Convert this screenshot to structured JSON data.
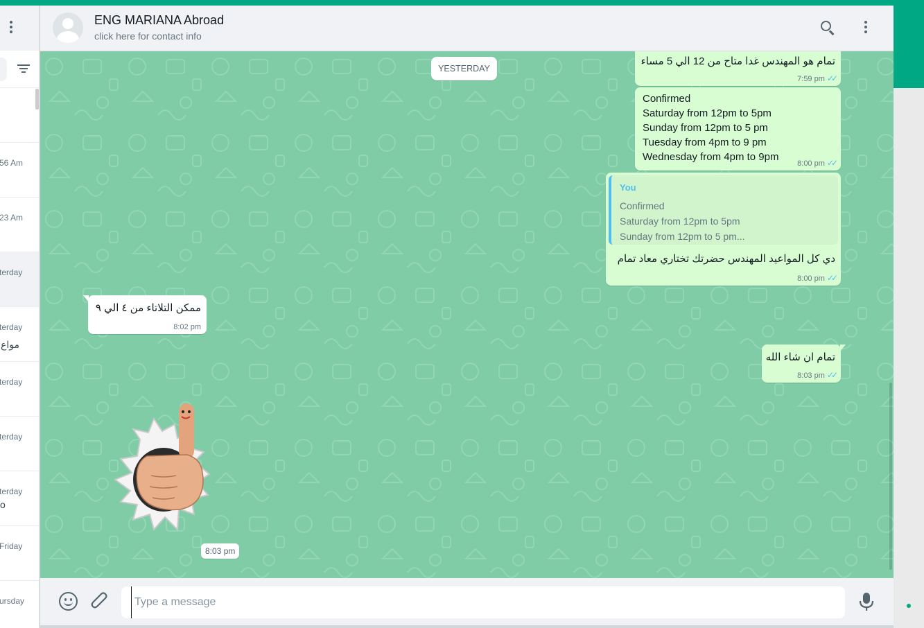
{
  "colors": {
    "accent": "#00a884",
    "outgoing": "#d9fdd3",
    "wallpaper": "#7fcca6",
    "ticks": "#53bdeb"
  },
  "sidebar": {
    "rows": [
      {
        "time": "",
        "sub": ""
      },
      {
        "time": "56 Am",
        "sub": ""
      },
      {
        "time": "23 Am",
        "sub": ""
      },
      {
        "time": "terday",
        "sub": ""
      },
      {
        "time": "terday",
        "sub": "مواع"
      },
      {
        "time": "terday",
        "sub": ""
      },
      {
        "time": "terday",
        "sub": ""
      },
      {
        "time": "terday",
        "sub": "o"
      },
      {
        "time": "Friday",
        "sub": ""
      },
      {
        "time": "ursday",
        "sub": ""
      }
    ]
  },
  "header": {
    "name": "ENG MARIANA Abroad",
    "subtitle": "click here for contact info",
    "icons": [
      "search-icon",
      "menu-icon"
    ]
  },
  "chat": {
    "date_chip": "YESTERDAY",
    "messages": [
      {
        "dir": "out",
        "text": "تمام هو المهندس غدا متاح من 12 الي 5 مساء",
        "time": "7:59 pm"
      },
      {
        "dir": "out",
        "lines": [
          "Confirmed",
          "Saturday from 12pm to 5pm",
          "Sunday from 12pm to 5 pm",
          "Tuesday from 4pm to 9 pm",
          "Wednesday from 4pm to 9pm"
        ],
        "time": "8:00 pm"
      },
      {
        "dir": "out",
        "quote": {
          "author": "You",
          "lines": [
            "Confirmed",
            "Saturday from 12pm to 5pm",
            "Sunday from 12pm to 5 pm..."
          ]
        },
        "text": "دي كل المواعيد المهندس حضرتك تختاري معاد تمام",
        "time": "8:00 pm"
      },
      {
        "dir": "in",
        "text": "ممكن التلاتاء من ٤ الي ٩",
        "time": "8:02 pm"
      },
      {
        "dir": "out",
        "text": "تمام ان شاء الله",
        "time": "8:03 pm"
      },
      {
        "dir": "in",
        "sticker": "thumbs-up-sticker",
        "time": "8:03 pm"
      }
    ],
    "ticks": "✓✓"
  },
  "footer": {
    "placeholder": "Type a message",
    "value": "",
    "icons": [
      "emoji-icon",
      "attach-icon",
      "mic-icon"
    ]
  }
}
